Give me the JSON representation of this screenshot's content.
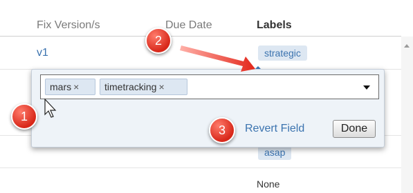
{
  "table": {
    "headers": {
      "fix_version": "Fix Version/s",
      "due_date": "Due Date",
      "labels": "Labels"
    },
    "rows": [
      {
        "fix_version": "v1",
        "label": "strategic"
      },
      {
        "label": "asap"
      },
      {
        "label": "None"
      }
    ]
  },
  "editor": {
    "chips": [
      {
        "text": "mars",
        "remove": "×"
      },
      {
        "text": "timetracking",
        "remove": "×"
      }
    ],
    "revert_label": "Revert Field",
    "done_label": "Done"
  },
  "callouts": [
    "1",
    "2",
    "3"
  ],
  "colors": {
    "link": "#3b73af",
    "lozenge_bg": "#dde7f2",
    "callout": "#e03a2a"
  },
  "icons": [
    "mouse-cursor-icon",
    "dropdown-arrow-icon",
    "scroll-up-icon",
    "remove-chip-icon",
    "callout-arrow-icon"
  ]
}
